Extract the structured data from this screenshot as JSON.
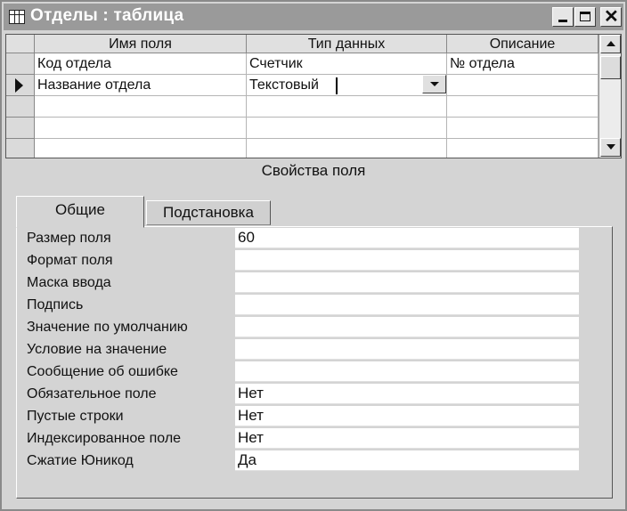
{
  "window": {
    "title": "Отделы : таблица",
    "controls": {
      "minimize": "minimize",
      "maximize": "maximize",
      "close": "close"
    }
  },
  "grid": {
    "columns": [
      "Имя поля",
      "Тип данных",
      "Описание"
    ],
    "rows": [
      {
        "field_name": "Код отдела",
        "data_type": "Счетчик",
        "description": "№ отдела"
      },
      {
        "field_name": "Название отдела",
        "data_type": "Текстовый",
        "description": ""
      },
      {
        "field_name": "",
        "data_type": "",
        "description": ""
      },
      {
        "field_name": "",
        "data_type": "",
        "description": ""
      },
      {
        "field_name": "",
        "data_type": "",
        "description": ""
      }
    ],
    "current_row": 2
  },
  "properties": {
    "title": "Свойства поля",
    "tabs": [
      "Общие",
      "Подстановка"
    ],
    "active_tab": "Общие",
    "items": [
      {
        "label": "Размер поля",
        "value": "60"
      },
      {
        "label": "Формат поля",
        "value": ""
      },
      {
        "label": "Маска ввода",
        "value": ""
      },
      {
        "label": "Подпись",
        "value": ""
      },
      {
        "label": "Значение по умолчанию",
        "value": ""
      },
      {
        "label": "Условие на значение",
        "value": ""
      },
      {
        "label": "Сообщение об ошибке",
        "value": ""
      },
      {
        "label": "Обязательное поле",
        "value": "Нет"
      },
      {
        "label": "Пустые строки",
        "value": "Нет"
      },
      {
        "label": "Индексированное поле",
        "value": "Нет"
      },
      {
        "label": "Сжатие Юникод",
        "value": "Да"
      }
    ]
  },
  "icons": {
    "app": "table-icon",
    "row_pointer": "row-pointer-icon",
    "dropdown": "chevron-down-icon",
    "scroll_up": "arrow-up-icon",
    "scroll_down": "arrow-down-icon"
  }
}
